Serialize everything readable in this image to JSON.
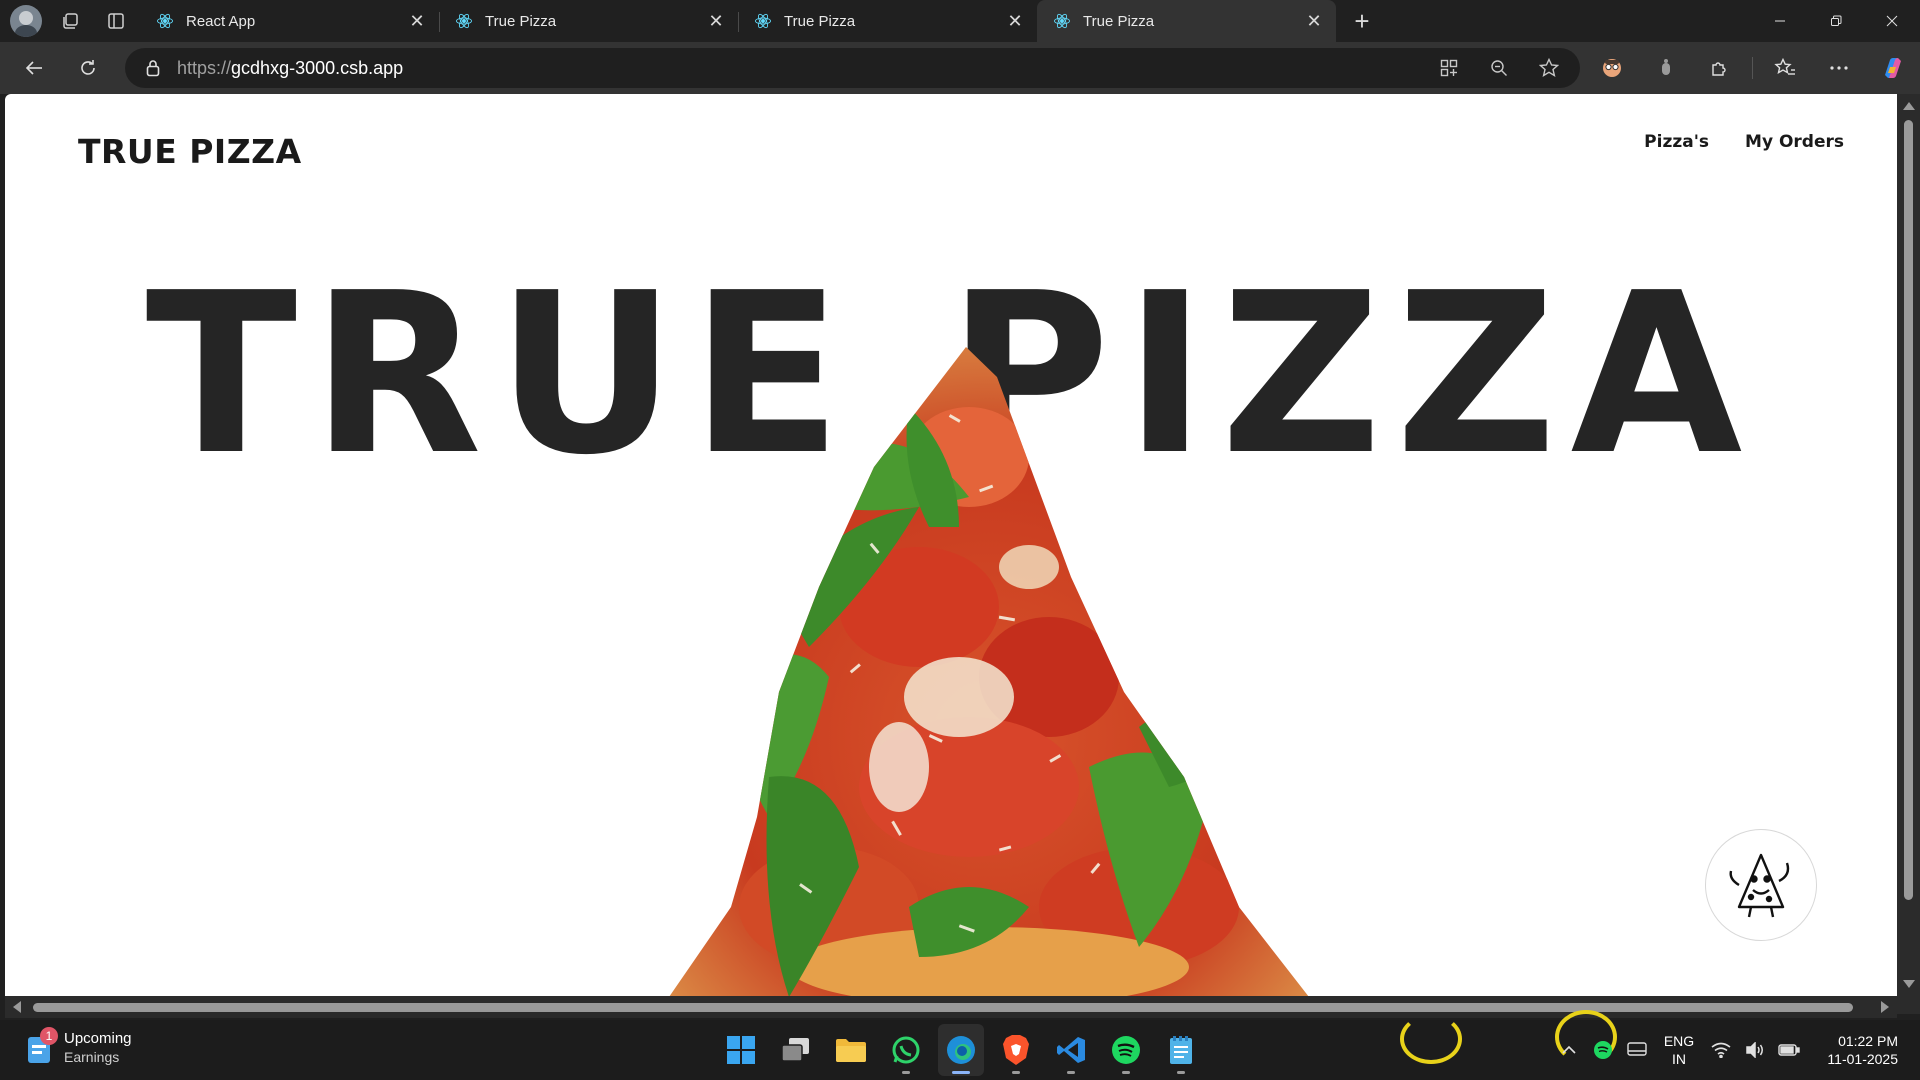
{
  "browser": {
    "tabs": [
      {
        "title": "React App",
        "active": false
      },
      {
        "title": "True Pizza",
        "active": false
      },
      {
        "title": "True Pizza",
        "active": false
      },
      {
        "title": "True Pizza",
        "active": true
      }
    ],
    "url_scheme": "https://",
    "url_host": "gcdhxg-3000.csb.app"
  },
  "site": {
    "logo": "TRUE PIZZA",
    "nav": [
      {
        "label": "Pizza's"
      },
      {
        "label": "My Orders"
      }
    ],
    "hero_title": "TRUE PIZZA"
  },
  "taskbar": {
    "widget_badge": "1",
    "widget_title": "Upcoming",
    "widget_subtitle": "Earnings",
    "apps": [
      "windows-start",
      "task-view",
      "file-explorer",
      "whatsapp",
      "edge",
      "brave",
      "vscode",
      "spotify",
      "notepad"
    ],
    "lang_line1": "ENG",
    "lang_line2": "IN",
    "time": "01:22 PM",
    "date": "11-01-2025"
  },
  "colors": {
    "chrome_dark": "#202020",
    "toolbar": "#333333",
    "hero_text": "#252525",
    "accent_blue": "#8ab4f8"
  }
}
